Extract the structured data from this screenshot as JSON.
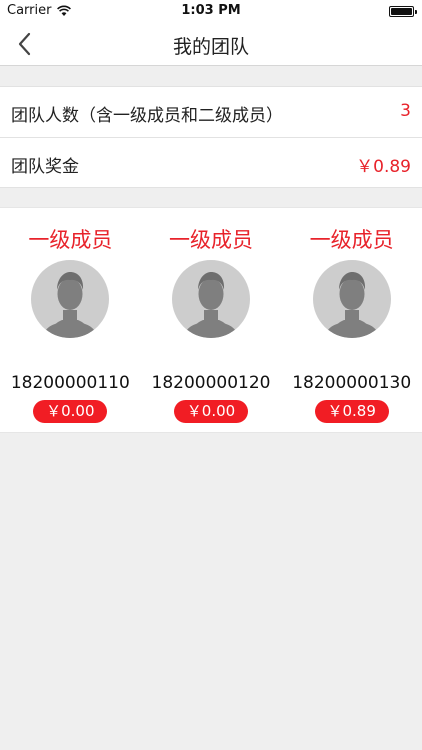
{
  "status_bar": {
    "carrier": "Carrier",
    "time": "1:03 PM"
  },
  "nav": {
    "title": "我的团队"
  },
  "team_info": {
    "size_label": "团队人数（含一级成员和二级成员）",
    "size_value": "3",
    "bonus_label": "团队奖金",
    "bonus_value": "￥0.89"
  },
  "members": [
    {
      "level": "一级成员",
      "phone": "18200000110",
      "amount": "￥0.00"
    },
    {
      "level": "一级成员",
      "phone": "18200000120",
      "amount": "￥0.00"
    },
    {
      "level": "一级成员",
      "phone": "18200000130",
      "amount": "￥0.89"
    }
  ],
  "colors": {
    "accent": "#e8232b",
    "badge": "#f11d24",
    "background": "#efefef"
  },
  "icons": {
    "back": "chevron-left-icon",
    "avatar": "user-silhouette-icon",
    "wifi": "wifi-icon",
    "battery": "battery-icon"
  }
}
